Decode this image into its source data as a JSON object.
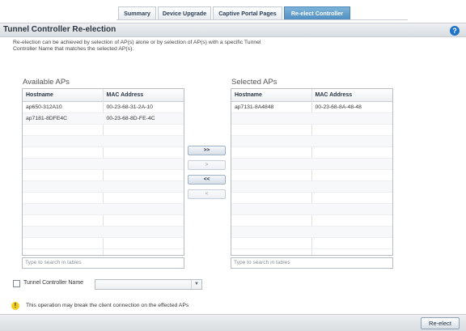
{
  "tabs": [
    {
      "label": "Summary",
      "active": false
    },
    {
      "label": "Device Upgrade",
      "active": false
    },
    {
      "label": "Captive Portal Pages",
      "active": false
    },
    {
      "label": "Re-elect Controller",
      "active": true
    }
  ],
  "header": {
    "title": "Tunnel Controller Re-election",
    "help_icon": "help-icon"
  },
  "description": "Re-election can be achieved by selection of AP(s) alone or by selection of AP(s) with a specific Tunnel Controller Name that matches the selected AP(s).",
  "available": {
    "label": "Available APs",
    "columns": [
      "Hostname",
      "MAC Address"
    ],
    "rows": [
      [
        "ap650-312A10",
        "00-23-68-31-2A-10"
      ],
      [
        "ap7181-8DFE4C",
        "00-23-68-8D-FE-4C"
      ]
    ],
    "search_placeholder": "Type to search in tables"
  },
  "selected": {
    "label": "Selected APs",
    "columns": [
      "Hostname",
      "MAC Address"
    ],
    "rows": [
      [
        "ap7131-8A4848",
        "00-23-68-8A-48-48"
      ]
    ],
    "search_placeholder": "Type to search in tables"
  },
  "move_buttons": {
    "move_all_right": ">>",
    "move_right": ">",
    "move_all_left": "<<",
    "move_left": "<"
  },
  "tunnel_controller": {
    "label": "Tunnel Controller Name",
    "value": "",
    "checked": false
  },
  "warning": {
    "text": "This operation may break the client connection on the effected APs",
    "icon": "warning-icon"
  },
  "footer": {
    "reelect_label": "Re-elect"
  },
  "colors": {
    "accent": "#4f8fc2",
    "help": "#1f73c8",
    "warning": "#f2cf1f"
  }
}
